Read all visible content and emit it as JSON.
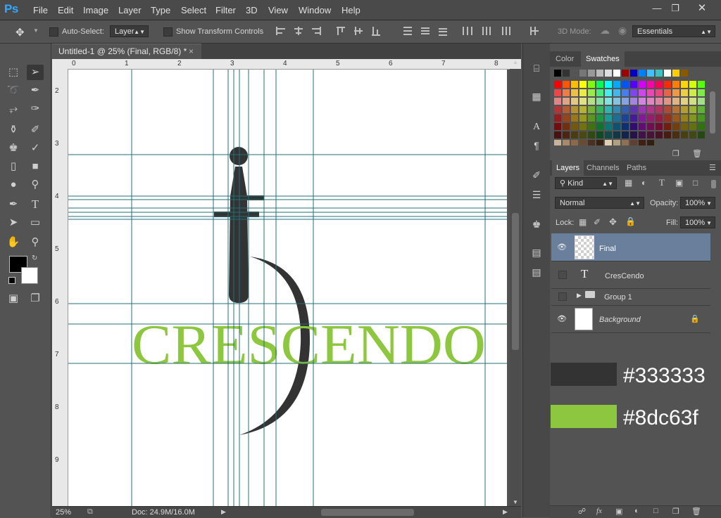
{
  "app": {
    "logo": "Ps"
  },
  "menu": [
    "File",
    "Edit",
    "Image",
    "Layer",
    "Type",
    "Select",
    "Filter",
    "3D",
    "View",
    "Window",
    "Help"
  ],
  "options": {
    "auto_select_label": "Auto-Select:",
    "auto_select_value": "Layer",
    "show_transform_label": "Show Transform Controls",
    "mode_3d_label": "3D Mode:",
    "workspace": "Essentials"
  },
  "document": {
    "tab_title": "Untitled-1 @ 25% (Final, RGB/8) *",
    "ruler_top": [
      "0",
      "1",
      "2",
      "3",
      "4",
      "5",
      "6",
      "7",
      "8"
    ],
    "ruler_left": [
      "2",
      "3",
      "4",
      "5",
      "6",
      "7",
      "8",
      "9"
    ],
    "logo_text": "CRESCENDO",
    "zoom": "25%",
    "doc_size": "Doc: 24.9M/16.0M"
  },
  "swatches_panel": {
    "tabs": [
      "Color",
      "Swatches"
    ],
    "active": "Swatches"
  },
  "layers_panel": {
    "tabs": [
      "Layers",
      "Channels",
      "Paths"
    ],
    "active": "Layers",
    "filter": "Kind",
    "blend_mode": "Normal",
    "opacity_label": "Opacity:",
    "opacity": "100%",
    "lock_label": "Lock:",
    "fill_label": "Fill:",
    "fill": "100%",
    "layers": [
      {
        "name": "Final",
        "visible": true,
        "selected": true
      },
      {
        "name": "CresCendo",
        "visible": false
      },
      {
        "name": "Group 1",
        "visible": false
      },
      {
        "name": "Background",
        "visible": true,
        "locked": true
      }
    ]
  },
  "color_notes": [
    {
      "label": "#333333",
      "color": "#333333"
    },
    {
      "label": "#8dc63f",
      "color": "#8dc63f"
    }
  ],
  "colors": {
    "logo_dark": "#333333",
    "logo_green": "#8dc63f",
    "guide": "#1f6f78",
    "selection": "#6a7f9c"
  }
}
